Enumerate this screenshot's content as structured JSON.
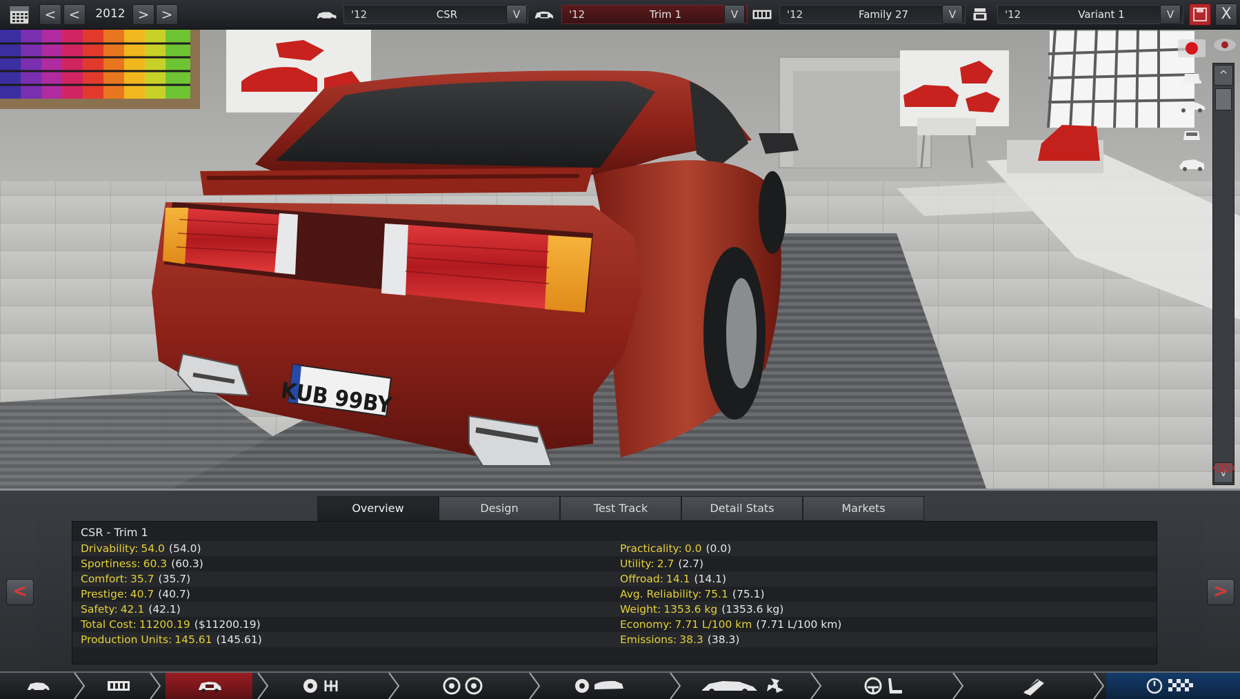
{
  "topbar": {
    "year": "2012",
    "car": {
      "year": "'12",
      "name": "CSR"
    },
    "trim": {
      "year": "'12",
      "name": "Trim 1"
    },
    "family": {
      "year": "'12",
      "name": "Family 27"
    },
    "variant": {
      "year": "'12",
      "name": "Variant 1"
    },
    "dropdown_label": "V",
    "prev_fast": "<",
    "prev": "<",
    "next": ">",
    "next_fast": ">",
    "close": "X"
  },
  "viewport": {
    "license_plate": "KUB 99BY",
    "scroll_up": "^",
    "scroll_down": "v"
  },
  "panel": {
    "tabs": [
      "Overview",
      "Design",
      "Test Track",
      "Detail Stats",
      "Markets"
    ],
    "active_tab": "Overview",
    "title": "CSR - Trim 1",
    "prev_arrow": "<",
    "next_arrow": ">",
    "left_stats": [
      {
        "label": "Drivability:",
        "value": "54.0",
        "base": "(54.0)"
      },
      {
        "label": "Sportiness:",
        "value": "60.3",
        "base": "(60.3)"
      },
      {
        "label": "Comfort:",
        "value": "35.7",
        "base": "(35.7)"
      },
      {
        "label": "Prestige:",
        "value": "40.7",
        "base": "(40.7)"
      },
      {
        "label": "Safety:",
        "value": "42.1",
        "base": "(42.1)"
      },
      {
        "label": "Total Cost:",
        "value": "11200.19",
        "base": "($11200.19)"
      },
      {
        "label": "Production Units:",
        "value": "145.61",
        "base": "(145.61)"
      }
    ],
    "right_stats": [
      {
        "label": "Practicality:",
        "value": "0.0",
        "base": "(0.0)"
      },
      {
        "label": "Utility:",
        "value": "2.7",
        "base": "(2.7)"
      },
      {
        "label": "Offroad:",
        "value": "14.1",
        "base": "(14.1)"
      },
      {
        "label": "Avg. Reliability:",
        "value": "75.1",
        "base": "(75.1)"
      },
      {
        "label": "Weight:",
        "value": "1353.6 kg",
        "base": "(1353.6 kg)"
      },
      {
        "label": "Economy:",
        "value": "7.71 L/100 km",
        "base": "(7.71 L/100 km)"
      },
      {
        "label": "Emissions:",
        "value": "38.3",
        "base": "(38.3)"
      }
    ]
  },
  "bottomnav": {
    "steps": [
      {
        "icon": "car-model-icon",
        "active": false
      },
      {
        "icon": "engine-family-icon",
        "active": false
      },
      {
        "icon": "trim-icon",
        "active": true
      },
      {
        "icon": "chassis-gearbox-icon",
        "active": false
      },
      {
        "icon": "wheels-icon",
        "active": false
      },
      {
        "icon": "suspension-body-icon",
        "active": false
      },
      {
        "icon": "body-aero-icon",
        "active": false
      },
      {
        "icon": "interior-icon",
        "active": false
      },
      {
        "icon": "fuel-system-icon",
        "active": false
      },
      {
        "icon": "test-finish-icon",
        "active": false
      }
    ]
  },
  "colors": {
    "accent_red": "#b2272b",
    "stat_yellow": "#e6d13a",
    "car_body": "#8e2219"
  }
}
